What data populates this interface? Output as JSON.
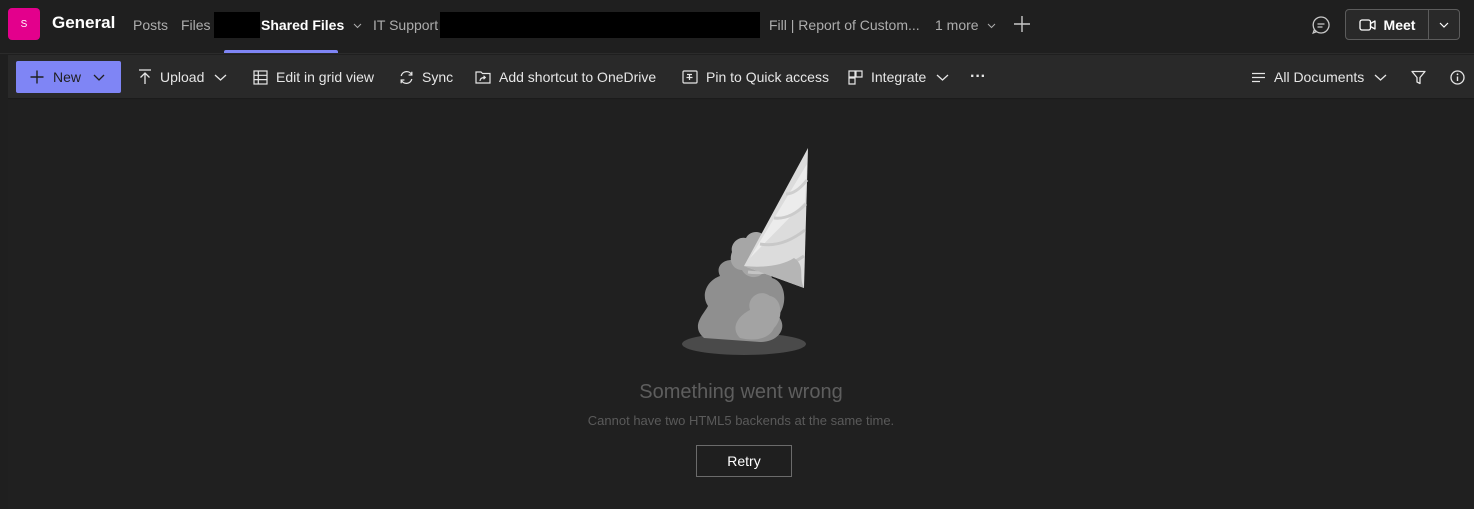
{
  "header": {
    "team_avatar_letter": "S",
    "team_color": "#e3008c",
    "channel_name": "General",
    "tabs": [
      {
        "label": "Posts"
      },
      {
        "label": "Files"
      },
      {
        "label": "Shared Files"
      },
      {
        "label": "IT Support"
      },
      {
        "label": "Fill | Report of Custom..."
      },
      {
        "label": "1 more"
      }
    ],
    "meet_label": "Meet"
  },
  "commands": {
    "new_label": "New",
    "upload_label": "Upload",
    "grid_label": "Edit in grid view",
    "sync_label": "Sync",
    "shortcut_label": "Add shortcut to OneDrive",
    "pin_label": "Pin to Quick access",
    "integrate_label": "Integrate",
    "more_label": "···",
    "view_label": "All Documents"
  },
  "error": {
    "title": "Something went wrong",
    "message": "Cannot have two HTML5 backends at the same time.",
    "retry_label": "Retry"
  },
  "colors": {
    "accent": "#7f85f5",
    "background": "#1f1f1f",
    "toolbar": "#292929"
  }
}
